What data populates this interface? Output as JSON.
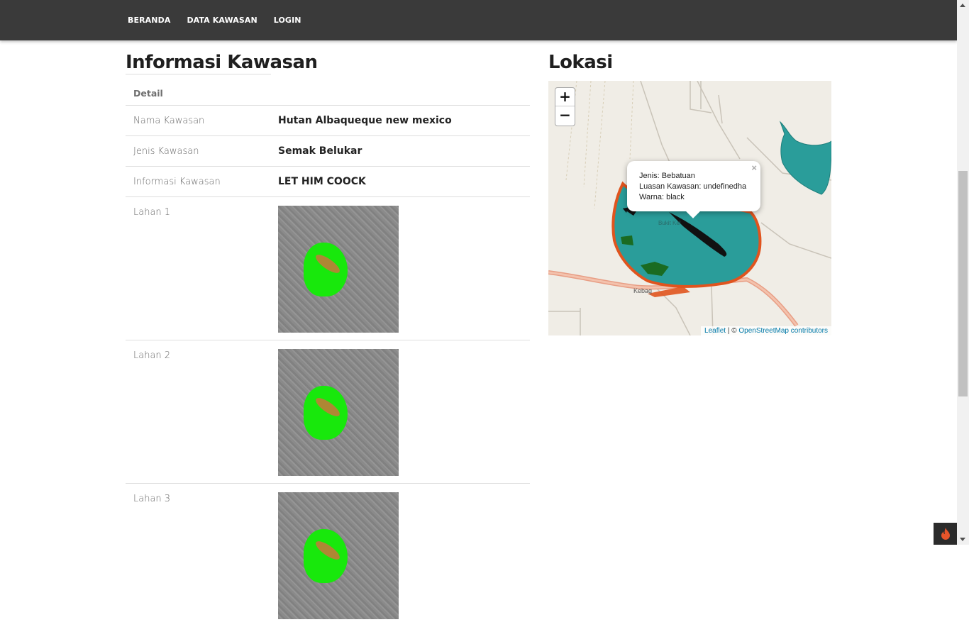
{
  "nav": {
    "items": [
      "BERANDA",
      "DATA KAWASAN",
      "LOGIN"
    ]
  },
  "info": {
    "title": "Informasi Kawasan",
    "head": "Detail",
    "rows": [
      {
        "label": "Nama Kawasan",
        "value": "Hutan Albaqueque new mexico"
      },
      {
        "label": "Jenis Kawasan",
        "value": "Semak Belukar"
      },
      {
        "label": "Informasi Kawasan",
        "value": "LET HIM COOCK"
      }
    ],
    "lahan": [
      "Lahan 1",
      "Lahan 2",
      "Lahan 3"
    ]
  },
  "location": {
    "title": "Lokasi",
    "zoom_in": "+",
    "zoom_out": "−",
    "popup": {
      "line1": "Jenis: Bebatuan",
      "line2": "Luasan Kawasan: undefinedha",
      "line3": "Warna: black",
      "close": "×"
    },
    "map_labels": {
      "town": "Kebag",
      "hill": "Bukit Kel"
    },
    "attribution": {
      "leaflet": "Leaflet",
      "separator": " | © ",
      "osm": "OpenStreetMap contributors"
    }
  },
  "colors": {
    "topbar": "#3a3a3a",
    "polygon": "#2a9d9a",
    "orange": "#e0541e",
    "green": "#1a6b22",
    "black": "#111111"
  }
}
